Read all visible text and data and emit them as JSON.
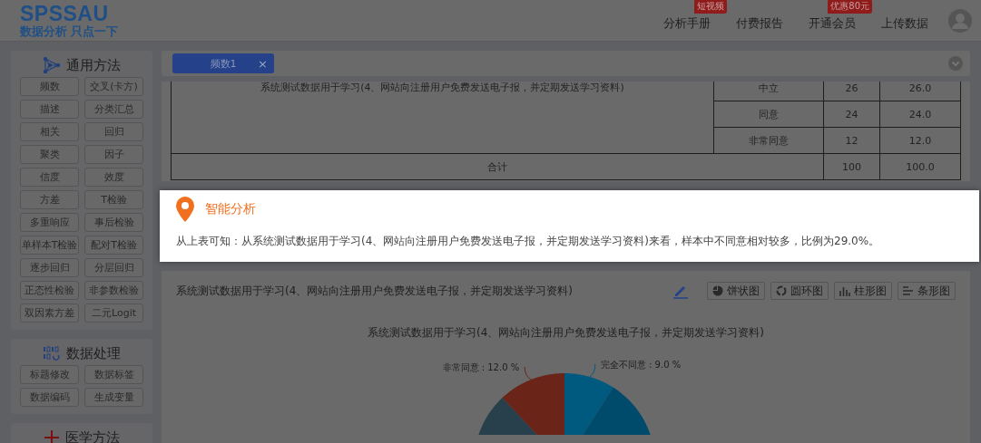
{
  "header": {
    "logo": "SPSSAU",
    "slogan": "数据分析 只点一下",
    "nav": [
      {
        "label": "分析手册",
        "badge": "短视频"
      },
      {
        "label": "付费报告"
      },
      {
        "label": "开通会员",
        "badge": "优惠80元"
      },
      {
        "label": "上传数据"
      }
    ]
  },
  "sidebar": {
    "sections": [
      {
        "title": "通用方法",
        "items": [
          "频数",
          "交叉(卡方)",
          "描述",
          "分类汇总",
          "相关",
          "回归",
          "聚类",
          "因子",
          "信度",
          "效度",
          "方差",
          "T检验",
          "多重响应",
          "事后检验",
          "单样本T检验",
          "配对T检验",
          "逐步回归",
          "分层回归",
          "正态性检验",
          "非参数检验",
          "双因素方差",
          "二元Logit"
        ]
      },
      {
        "title": "数据处理",
        "items": [
          "标题修改",
          "数据标签",
          "数据编码",
          "生成变量"
        ]
      },
      {
        "title": "医学方法"
      }
    ]
  },
  "tabs": [
    {
      "label": "频数1",
      "selected": true,
      "close": "×"
    }
  ],
  "table": {
    "name": "系统测试数据用于学习(4、网站向注册用户免费发送电子报，并定期发送学习资料)",
    "rows": [
      {
        "option": "中立",
        "count": "26",
        "percent": "26.0"
      },
      {
        "option": "同意",
        "count": "24",
        "percent": "24.0"
      },
      {
        "option": "非常同意",
        "count": "12",
        "percent": "12.0"
      }
    ],
    "total": {
      "label": "合计",
      "count": "100",
      "percent": "100.0"
    }
  },
  "analysis": {
    "title": "智能分析",
    "text": "从上表可知：从系统测试数据用于学习(4、网站向注册用户免费发送电子报，并定期发送学习资料)来看，样本中不同意相对较多，比例为29.0%。"
  },
  "chart_card": {
    "title": "系统测试数据用于学习(4、网站向注册用户免费发送电子报，并定期发送学习资料)",
    "buttons": [
      {
        "label": "饼状图"
      },
      {
        "label": "圆环图"
      },
      {
        "label": "柱形图"
      },
      {
        "label": "条形图"
      }
    ],
    "chart_title": "系统测试数据用于学习(4、网站向注册用户免费发送电子报，并定期发送学习资料)",
    "pie_labels": [
      {
        "text": "非常同意 : 12.0 %"
      },
      {
        "text": "完全不同意 : 9.0 %"
      }
    ]
  }
}
